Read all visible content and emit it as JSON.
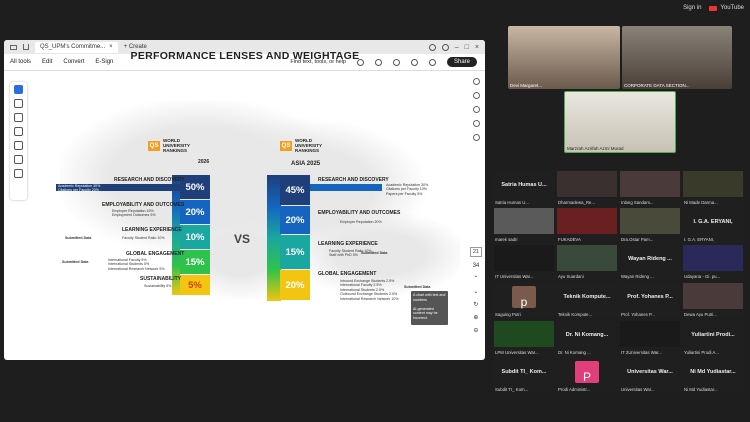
{
  "youtube": {
    "sign_in": "Sign in",
    "label": "YouTube"
  },
  "tab": {
    "title": "QS_UPM's Commitme...",
    "create": "Create"
  },
  "menu": {
    "all_tools": "All tools",
    "edit": "Edit",
    "convert": "Convert",
    "esign": "E-Sign",
    "find": "Find text, tools, or help",
    "share": "Share"
  },
  "slide": {
    "title": "PERFORMANCE LENSES AND WEIGHTAGE",
    "qs_left": {
      "badge": "QS",
      "line1": "WORLD",
      "line2": "UNIVERSITY",
      "line3": "RANKINGS",
      "year": "2026"
    },
    "qs_right": {
      "badge": "QS",
      "line1": "WORLD",
      "line2": "UNIVERSITY",
      "line3": "RANKINGS",
      "year": "ASIA 2025"
    },
    "vs": "VS",
    "left": [
      {
        "cat": "RESEARCH AND DISCOVERY",
        "val": "50%",
        "subs": "Academic Reputation 30%\nCitations per Faculty 20%"
      },
      {
        "cat": "EMPLOYABILITY AND OUTCOMES",
        "val": "20%",
        "subs": "Employer Reputation 15%\nEmployment Outcomes 5%"
      },
      {
        "cat": "LEARNING EXPERIENCE",
        "val": "10%",
        "subs": "Faculty Student Ratio 10%"
      },
      {
        "cat": "GLOBAL ENGAGEMENT",
        "val": "15%",
        "subs": "International Faculty 5%\nInternational Students 5%\nInternational Research Network 5%"
      },
      {
        "cat": "SUSTAINABILITY",
        "val": "5%",
        "subs": "Sustainability 5%"
      }
    ],
    "right": [
      {
        "cat": "RESEARCH AND DISCOVERY",
        "val": "45%",
        "subs": "Academic Reputation 30%\nCitations per Faculty 10%\nPapers per Faculty 5%"
      },
      {
        "cat": "EMPLOYABILITY AND OUTCOMES",
        "val": "20%",
        "subs": "Employer Reputation 20%"
      },
      {
        "cat": "LEARNING EXPERIENCE",
        "val": "15%",
        "subs": "Faculty Student Ratio 10%\nStaff with PhD 5%"
      },
      {
        "cat": "GLOBAL ENGAGEMENT",
        "val": "20%",
        "subs": "Inbound Exchange Students 2.5%\nInternational Faculty 2.5%\nInternational Students 2.5%\nOutbound Exchange Students 2.5%\nInternational Research Network 10%"
      }
    ],
    "submitted_data": "Submitted Data",
    "tooltip": "A chart with text and numbers\n\nAI-generated content may be incorrect."
  },
  "nav": {
    "page_current": "21",
    "page_total": "34",
    "page_bottom": "21"
  },
  "colors": {
    "navy": "#1f3f7a",
    "blue": "#1565c0",
    "teal": "#1aa7a0",
    "green": "#2fc24a",
    "yellow": "#f2c511",
    "orange": "#f28b1a",
    "qs": "#f0a020"
  },
  "speakers": [
    {
      "name": "Devi Margaret..."
    },
    {
      "name": "CORPORATE DATA SECTION..."
    },
    {
      "name": "Marzrah Azrifah Azmi Murad"
    }
  ],
  "tiles": [
    {
      "big": "Satria Humas U...",
      "small": "Satria Humas U...",
      "type": "text"
    },
    {
      "big": "",
      "small": "Dharmadewa_Re...",
      "type": "video",
      "color": "#3a3030"
    },
    {
      "big": "",
      "small": "Inlang Sandam...",
      "type": "video",
      "color": "#4a3a3a"
    },
    {
      "big": "",
      "small": "Ni Made Darma...",
      "type": "video",
      "color": "#3a3a2a"
    },
    {
      "big": "",
      "small": "marek sadri",
      "type": "video",
      "color": "#5a5a5a"
    },
    {
      "big": "",
      "small": "FUKADEVA",
      "type": "video",
      "color": "#6a2020"
    },
    {
      "big": "",
      "small": "Dra.Ostar Pam...",
      "type": "video",
      "color": "#4a4a3a"
    },
    {
      "big": "I. G.A. ERYANI,",
      "small": "I. G.A. ERYANI,",
      "type": "text"
    },
    {
      "big": "",
      "small": "IT Universitas War...",
      "type": "logo",
      "color": "#1a1a1a"
    },
    {
      "big": "",
      "small": "Ayu Suardani",
      "type": "video",
      "color": "#3a4a3a"
    },
    {
      "big": "Wayan Rideng ...",
      "small": "Wayan Rideng ...",
      "type": "text"
    },
    {
      "big": "",
      "small": "Udayana - Gi. pu...",
      "type": "video",
      "color": "#2a2a5a"
    },
    {
      "big": "",
      "small": "Saguing Putri",
      "type": "avatar",
      "letter": "p",
      "color": "#7a5a4a"
    },
    {
      "big": "Teknik Kompute...",
      "small": "Teknik Kompute...",
      "type": "text"
    },
    {
      "big": "Prof. Yohanes P...",
      "small": "Prof. Yohanes P...",
      "type": "text"
    },
    {
      "big": "",
      "small": "Dewa Ayu Putri...",
      "type": "video",
      "color": "#4a3a3a"
    },
    {
      "big": "",
      "small": "LPM Universitas War...",
      "type": "logo",
      "color": "#1f4a1f"
    },
    {
      "big": "Dr. Ni Komang...",
      "small": "Dr. Ni Komang ...",
      "type": "text"
    },
    {
      "big": "",
      "small": "IT 2Universitas War...",
      "type": "logo",
      "color": "#1a1a1a"
    },
    {
      "big": "Yuliartini Prodi...",
      "small": "Yuliartini Prodi A...",
      "type": "text"
    },
    {
      "big": "Subdit TI_ Kom...",
      "small": "Subdit TI_ Kom...",
      "type": "text"
    },
    {
      "big": "",
      "small": "Prodi Administr...",
      "type": "avatar",
      "letter": "P",
      "color": "#e0407a"
    },
    {
      "big": "Universitas War...",
      "small": "Universitas War...",
      "type": "text"
    },
    {
      "big": "Ni Md Yudiastar...",
      "small": "Ni Md Yudiastar...",
      "type": "text"
    }
  ]
}
